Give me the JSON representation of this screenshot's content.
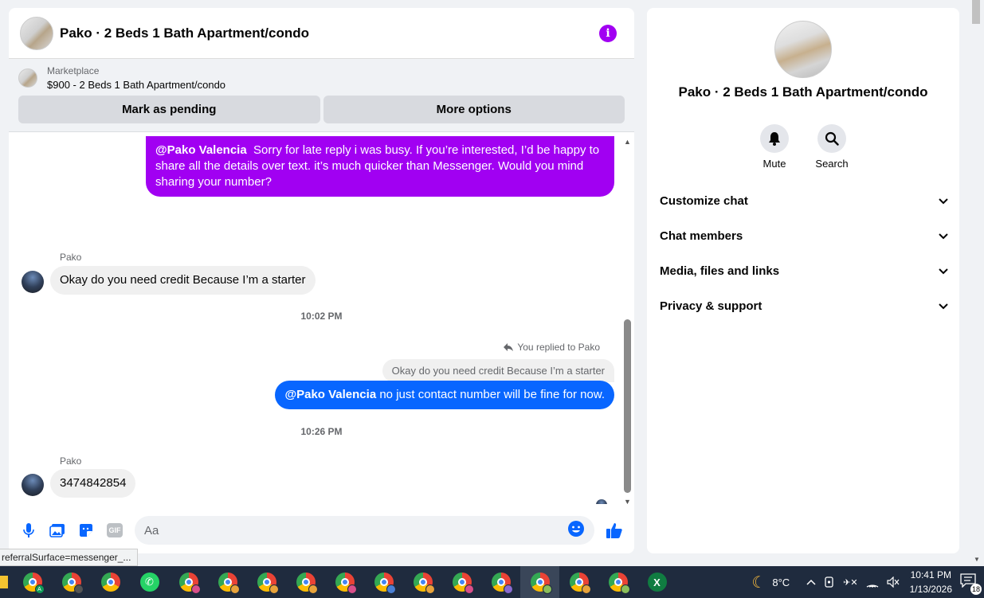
{
  "chat": {
    "title": "Pako · 2 Beds 1 Bath Apartment/condo",
    "marketplace_label": "Marketplace",
    "listing": "$900 - 2 Beds 1 Bath Apartment/condo",
    "mark_pending": "Mark as pending",
    "more_options": "More options",
    "msg1_mention": "@Pako Valencia",
    "msg1_text": "Sorry for late reply i was busy. If you’re interested, I’d be happy to share all the details over text. it’s much quicker than Messenger. Would you mind sharing your number?",
    "sender1": "Pako",
    "msg2": "Okay do you need credit Because I’m a starter",
    "time1": "10:02 PM",
    "reply_note": "You replied to Pako",
    "reply_quote": "Okay do you need credit Because I’m a starter",
    "msg3_mention": "@Pako Valencia",
    "msg3_text": "no just contact number will be fine for now.",
    "time2": "10:26 PM",
    "sender2": "Pako",
    "msg4": "3474842854",
    "input_placeholder": "Aa",
    "colors": {
      "purple_bubble": "#a100f2",
      "blue_bubble": "#0866ff"
    }
  },
  "side": {
    "title": "Pako · 2 Beds 1 Bath Apartment/condo",
    "mute": "Mute",
    "search": "Search",
    "menu": [
      "Customize chat",
      "Chat members",
      "Media, files and links",
      "Privacy & support"
    ]
  },
  "status_url": "referralSurface=messenger_...",
  "taskbar": {
    "weather": "8°C",
    "time": "10:41 PM",
    "date": "1/13/2026",
    "notifications": "18",
    "badges": [
      "A",
      "",
      "",
      "",
      "",
      "",
      "",
      "",
      "",
      "",
      "",
      "",
      "",
      "",
      ""
    ],
    "excel_letter": "X"
  }
}
